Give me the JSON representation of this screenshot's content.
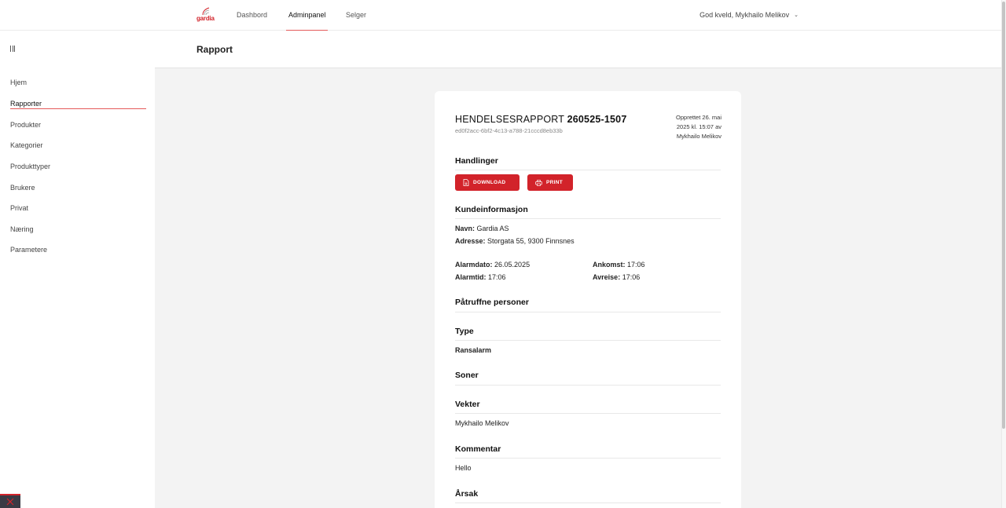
{
  "topnav": {
    "logo_text": "gardia",
    "links": [
      "Dashbord",
      "Adminpanel",
      "Selger"
    ],
    "active": "Adminpanel",
    "user_greeting": "God kveld, Mykhailo Melikov",
    "user_chevron_icon": "chevron-down-icon"
  },
  "sidebar": {
    "toggle_icon": "menu-icon",
    "items": [
      "Hjem",
      "Rapporter",
      "Produkter",
      "Kategorier",
      "Produkttyper",
      "Brukere",
      "Privat",
      "Næring",
      "Parametere"
    ],
    "active": "Rapporter"
  },
  "page": {
    "title": "Rapport"
  },
  "report": {
    "title_prefix": "HENDELSESRAPPORT",
    "number": "260525-1507",
    "uuid": "ed0f2acc-6bf2-4c13-a788-21cccd8eb33b",
    "created_line1": "Opprettet 26. mai",
    "created_line2": "2025 kl. 15:07 av",
    "created_line3": "Mykhailo Melikov"
  },
  "actions": {
    "title": "Handlinger",
    "download_label": "DOWNLOAD",
    "print_label": "PRINT"
  },
  "customer": {
    "title": "Kundeinformasjon",
    "name_label": "Navn:",
    "name_value": "Gardia AS",
    "address_label": "Adresse:",
    "address_value": "Storgata 55, 9300 Finnsnes",
    "alarm_date_label": "Alarmdato:",
    "alarm_date_value": "26.05.2025",
    "alarm_time_label": "Alarmtid:",
    "alarm_time_value": "17:06",
    "arrival_label": "Ankomst:",
    "arrival_value": "17:06",
    "departure_label": "Avreise:",
    "departure_value": "17:06"
  },
  "persons": {
    "title": "Påtruffne personer"
  },
  "type": {
    "title": "Type",
    "value": "Ransalarm"
  },
  "zones": {
    "title": "Soner"
  },
  "guard": {
    "title": "Vekter",
    "value": "Mykhailo Melikov"
  },
  "comment": {
    "title": "Kommentar",
    "value": "Hello"
  },
  "cause": {
    "title": "Årsak"
  },
  "colors": {
    "accent": "#d2232a",
    "underline": "#e45a5a",
    "page_bg": "#f3f3f3"
  }
}
